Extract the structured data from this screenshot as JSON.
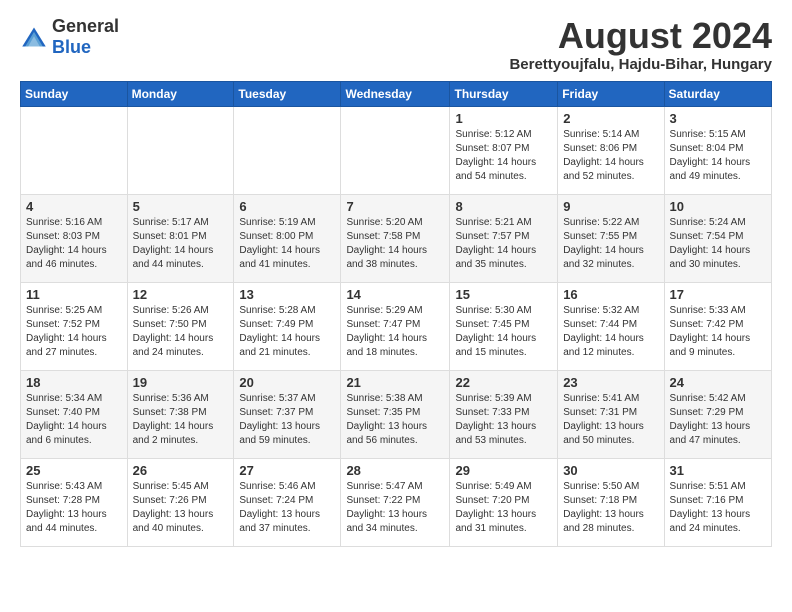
{
  "logo": {
    "general": "General",
    "blue": "Blue"
  },
  "title": {
    "month_year": "August 2024",
    "location": "Berettyoujfalu, Hajdu-Bihar, Hungary"
  },
  "weekdays": [
    "Sunday",
    "Monday",
    "Tuesday",
    "Wednesday",
    "Thursday",
    "Friday",
    "Saturday"
  ],
  "weeks": [
    [
      {
        "day": "",
        "detail": ""
      },
      {
        "day": "",
        "detail": ""
      },
      {
        "day": "",
        "detail": ""
      },
      {
        "day": "",
        "detail": ""
      },
      {
        "day": "1",
        "detail": "Sunrise: 5:12 AM\nSunset: 8:07 PM\nDaylight: 14 hours\nand 54 minutes."
      },
      {
        "day": "2",
        "detail": "Sunrise: 5:14 AM\nSunset: 8:06 PM\nDaylight: 14 hours\nand 52 minutes."
      },
      {
        "day": "3",
        "detail": "Sunrise: 5:15 AM\nSunset: 8:04 PM\nDaylight: 14 hours\nand 49 minutes."
      }
    ],
    [
      {
        "day": "4",
        "detail": "Sunrise: 5:16 AM\nSunset: 8:03 PM\nDaylight: 14 hours\nand 46 minutes."
      },
      {
        "day": "5",
        "detail": "Sunrise: 5:17 AM\nSunset: 8:01 PM\nDaylight: 14 hours\nand 44 minutes."
      },
      {
        "day": "6",
        "detail": "Sunrise: 5:19 AM\nSunset: 8:00 PM\nDaylight: 14 hours\nand 41 minutes."
      },
      {
        "day": "7",
        "detail": "Sunrise: 5:20 AM\nSunset: 7:58 PM\nDaylight: 14 hours\nand 38 minutes."
      },
      {
        "day": "8",
        "detail": "Sunrise: 5:21 AM\nSunset: 7:57 PM\nDaylight: 14 hours\nand 35 minutes."
      },
      {
        "day": "9",
        "detail": "Sunrise: 5:22 AM\nSunset: 7:55 PM\nDaylight: 14 hours\nand 32 minutes."
      },
      {
        "day": "10",
        "detail": "Sunrise: 5:24 AM\nSunset: 7:54 PM\nDaylight: 14 hours\nand 30 minutes."
      }
    ],
    [
      {
        "day": "11",
        "detail": "Sunrise: 5:25 AM\nSunset: 7:52 PM\nDaylight: 14 hours\nand 27 minutes."
      },
      {
        "day": "12",
        "detail": "Sunrise: 5:26 AM\nSunset: 7:50 PM\nDaylight: 14 hours\nand 24 minutes."
      },
      {
        "day": "13",
        "detail": "Sunrise: 5:28 AM\nSunset: 7:49 PM\nDaylight: 14 hours\nand 21 minutes."
      },
      {
        "day": "14",
        "detail": "Sunrise: 5:29 AM\nSunset: 7:47 PM\nDaylight: 14 hours\nand 18 minutes."
      },
      {
        "day": "15",
        "detail": "Sunrise: 5:30 AM\nSunset: 7:45 PM\nDaylight: 14 hours\nand 15 minutes."
      },
      {
        "day": "16",
        "detail": "Sunrise: 5:32 AM\nSunset: 7:44 PM\nDaylight: 14 hours\nand 12 minutes."
      },
      {
        "day": "17",
        "detail": "Sunrise: 5:33 AM\nSunset: 7:42 PM\nDaylight: 14 hours\nand 9 minutes."
      }
    ],
    [
      {
        "day": "18",
        "detail": "Sunrise: 5:34 AM\nSunset: 7:40 PM\nDaylight: 14 hours\nand 6 minutes."
      },
      {
        "day": "19",
        "detail": "Sunrise: 5:36 AM\nSunset: 7:38 PM\nDaylight: 14 hours\nand 2 minutes."
      },
      {
        "day": "20",
        "detail": "Sunrise: 5:37 AM\nSunset: 7:37 PM\nDaylight: 13 hours\nand 59 minutes."
      },
      {
        "day": "21",
        "detail": "Sunrise: 5:38 AM\nSunset: 7:35 PM\nDaylight: 13 hours\nand 56 minutes."
      },
      {
        "day": "22",
        "detail": "Sunrise: 5:39 AM\nSunset: 7:33 PM\nDaylight: 13 hours\nand 53 minutes."
      },
      {
        "day": "23",
        "detail": "Sunrise: 5:41 AM\nSunset: 7:31 PM\nDaylight: 13 hours\nand 50 minutes."
      },
      {
        "day": "24",
        "detail": "Sunrise: 5:42 AM\nSunset: 7:29 PM\nDaylight: 13 hours\nand 47 minutes."
      }
    ],
    [
      {
        "day": "25",
        "detail": "Sunrise: 5:43 AM\nSunset: 7:28 PM\nDaylight: 13 hours\nand 44 minutes."
      },
      {
        "day": "26",
        "detail": "Sunrise: 5:45 AM\nSunset: 7:26 PM\nDaylight: 13 hours\nand 40 minutes."
      },
      {
        "day": "27",
        "detail": "Sunrise: 5:46 AM\nSunset: 7:24 PM\nDaylight: 13 hours\nand 37 minutes."
      },
      {
        "day": "28",
        "detail": "Sunrise: 5:47 AM\nSunset: 7:22 PM\nDaylight: 13 hours\nand 34 minutes."
      },
      {
        "day": "29",
        "detail": "Sunrise: 5:49 AM\nSunset: 7:20 PM\nDaylight: 13 hours\nand 31 minutes."
      },
      {
        "day": "30",
        "detail": "Sunrise: 5:50 AM\nSunset: 7:18 PM\nDaylight: 13 hours\nand 28 minutes."
      },
      {
        "day": "31",
        "detail": "Sunrise: 5:51 AM\nSunset: 7:16 PM\nDaylight: 13 hours\nand 24 minutes."
      }
    ]
  ]
}
